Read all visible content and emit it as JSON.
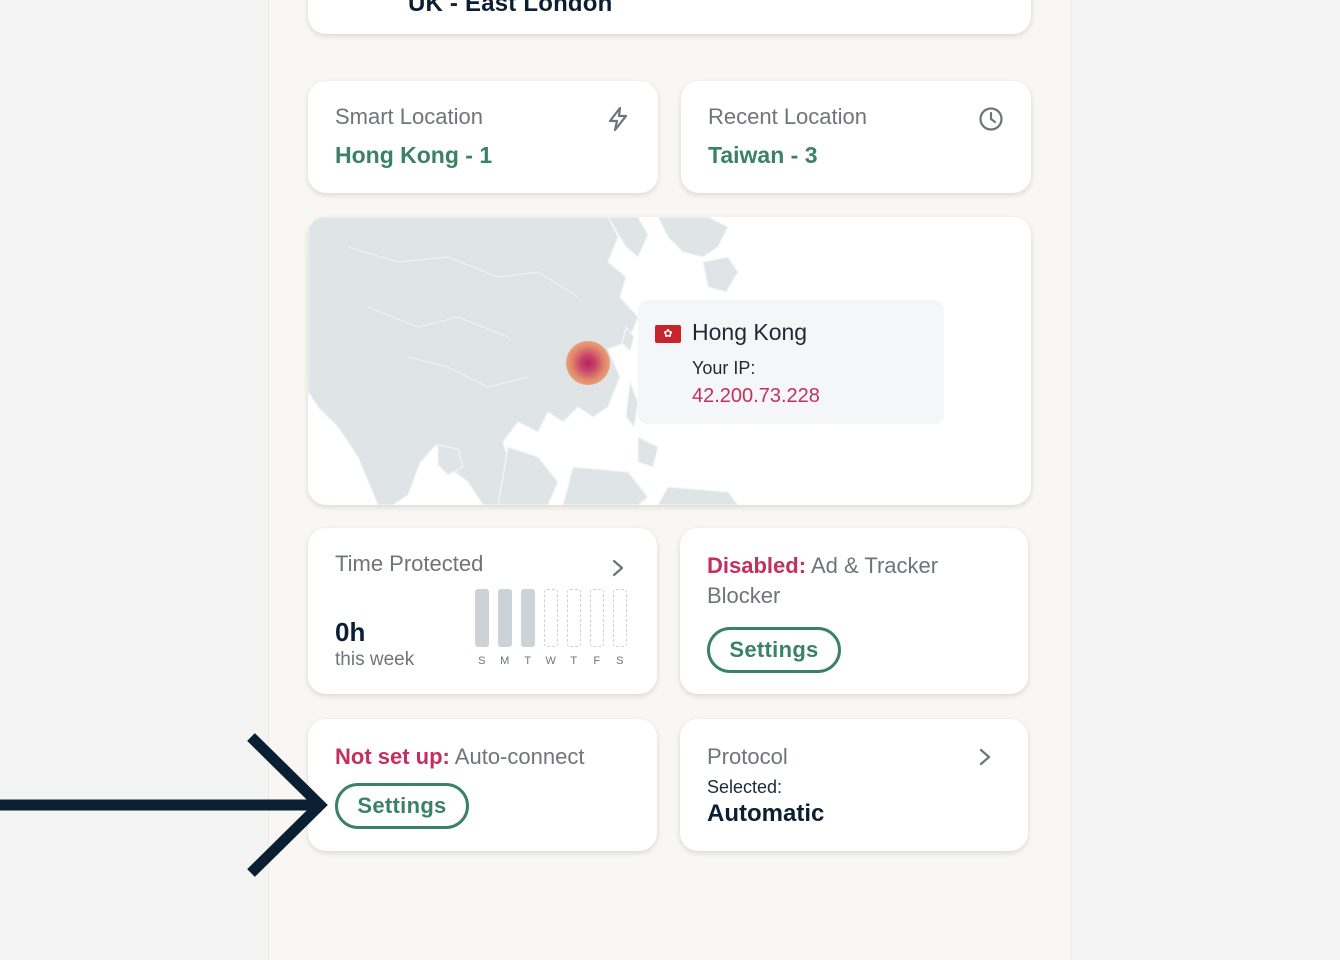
{
  "current_location": {
    "name": "UK - East London"
  },
  "smart_location": {
    "label": "Smart Location",
    "value": "Hong Kong - 1",
    "icon": "lightning-icon"
  },
  "recent_location": {
    "label": "Recent Location",
    "value": "Taiwan - 3",
    "icon": "clock-icon"
  },
  "map": {
    "country": "Hong Kong",
    "flag_icon": "hong-kong-flag-icon",
    "ip_label": "Your IP:",
    "ip_value": "42.200.73.228"
  },
  "time_protected": {
    "title": "Time Protected",
    "value": "0h",
    "subtitle": "this week",
    "days": [
      "S",
      "M",
      "T",
      "W",
      "T",
      "F",
      "S"
    ],
    "active_days": [
      true,
      true,
      true,
      false,
      false,
      false,
      false
    ]
  },
  "ad_blocker": {
    "status": "Disabled:",
    "label": "Ad & Tracker Blocker",
    "button": "Settings"
  },
  "auto_connect": {
    "status": "Not set up:",
    "label": "Auto-connect",
    "button": "Settings"
  },
  "protocol": {
    "title": "Protocol",
    "selected_label": "Selected:",
    "selected_value": "Automatic"
  },
  "colors": {
    "accent": "#3a8266",
    "alert": "#c3305f",
    "navy": "#0b1f33",
    "background": "#f8f7f4"
  }
}
